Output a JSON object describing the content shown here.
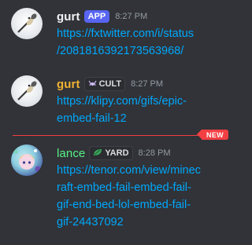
{
  "messages": [
    {
      "author": "gurt",
      "author_color": "#f2f3f5",
      "tag": "APP",
      "time": "8:27 PM",
      "avatar": "spoon-figure-avatar",
      "link_lines": [
        "https://fxtwitter.com/i/status",
        "/2081816392173563968/"
      ]
    },
    {
      "author": "gurt",
      "author_color": "#f0b232",
      "tag": "CULT",
      "tag_icon": "crab-icon",
      "time": "8:27 PM",
      "avatar": "spoon-figure-avatar",
      "link_lines": [
        "https://klipy.com/gifs/epic-",
        "embed-fail-12"
      ]
    },
    {
      "author": "lance",
      "author_color": "#57f287",
      "tag": "YARD",
      "tag_icon": "leaf-icon",
      "time": "8:28 PM",
      "avatar": "anime-girl-avatar",
      "link_lines": [
        "https://tenor.com/view/minec",
        "raft-embed-fail-embed-fail-",
        "gif-end-bed-lol-embed-fail-",
        "gif-24437092"
      ]
    }
  ],
  "new_divider": {
    "label": "NEW",
    "color": "#f23f43"
  },
  "colors": {
    "background": "#313338",
    "link": "#00a8fc",
    "app_tag": "#5865f2"
  }
}
